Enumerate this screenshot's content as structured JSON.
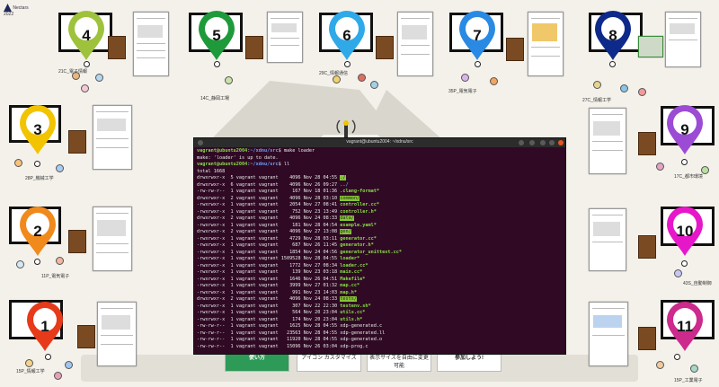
{
  "logo": {
    "text": "Nectars 2022",
    "mark_color": "#1d2a5a"
  },
  "booths": [
    {
      "num": "4",
      "color": "#9ec23c",
      "label": "21C_電子情報"
    },
    {
      "num": "5",
      "color": "#1e9a3a",
      "label": "14C_静岡工場"
    },
    {
      "num": "6",
      "color": "#2fa9e8",
      "label": "29C_情報通信"
    },
    {
      "num": "7",
      "color": "#2a8ae3",
      "label": "35P_電気電子"
    },
    {
      "num": "8",
      "color": "#0d2a8a",
      "label": "27C_情報工学"
    },
    {
      "num": "3",
      "color": "#f2c400",
      "label": "28P_機械工学"
    },
    {
      "num": "9",
      "color": "#9b4bd4",
      "label": "17C_都市環境"
    },
    {
      "num": "2",
      "color": "#f08a1c",
      "label": "11P_電気電子"
    },
    {
      "num": "10",
      "color": "#e617c8",
      "label": "43S_自動制御"
    },
    {
      "num": "1",
      "color": "#e63a1a",
      "label": "15P_情報工学"
    },
    {
      "num": "11",
      "color": "#cc2a8c",
      "label": "15P_工業電子"
    }
  ],
  "terminal": {
    "title": "vagrant@ubuntu2004: ~/xdnu/src",
    "user": "vagrant@ubuntu2004",
    "path": "~/xdnu/src",
    "lines": [
      {
        "kind": "cmd",
        "text": "make loader"
      },
      {
        "kind": "out",
        "text": "make: 'loader' is up to date."
      },
      {
        "kind": "cmd",
        "text": "ll"
      },
      {
        "kind": "out",
        "text": "total 1668"
      },
      {
        "kind": "ls",
        "meta": "drwxrwxr-x  5 vagrant vagrant    4096 Nov 28 04:55 ",
        "name": "./",
        "style": "dirhl"
      },
      {
        "kind": "ls",
        "meta": "drwxrwxr-x  6 vagrant vagrant    4096 Nov 26 09:27 ",
        "name": "../",
        "style": "dir"
      },
      {
        "kind": "ls",
        "meta": "-rw-rw-r--  1 vagrant vagrant     167 Nov 18 01:36 ",
        "name": ".clang-format*",
        "style": "exe"
      },
      {
        "kind": "ls",
        "meta": "drwxrwxr-x  2 vagrant vagrant    4096 Nov 28 03:10 ",
        "name": "common/",
        "style": "dirhl"
      },
      {
        "kind": "ls",
        "meta": "-rwxrwxr-x  1 vagrant vagrant    2054 Nov 27 08:41 ",
        "name": "controller.cc*",
        "style": "exe"
      },
      {
        "kind": "ls",
        "meta": "-rwxrwxr-x  1 vagrant vagrant     752 Nov 23 13:49 ",
        "name": "controller.h*",
        "style": "exe"
      },
      {
        "kind": "ls",
        "meta": "drwxrwxr-x  2 vagrant vagrant    4096 Nov 24 08:33 ",
        "name": "data/",
        "style": "dirhl"
      },
      {
        "kind": "ls",
        "meta": "-rwxrwxr-x  1 vagrant vagrant     181 Nov 28 04:54 ",
        "name": "example.yaml*",
        "style": "exe"
      },
      {
        "kind": "ls",
        "meta": "drwxrwxr-x  2 vagrant vagrant    4096 Nov 27 13:08 ",
        "name": "gen/",
        "style": "dirhl"
      },
      {
        "kind": "ls",
        "meta": "-rwxrwxr-x  1 vagrant vagrant    4729 Nov 28 03:11 ",
        "name": "generator.cc*",
        "style": "exe"
      },
      {
        "kind": "ls",
        "meta": "-rwxrwxr-x  1 vagrant vagrant     687 Nov 26 11:45 ",
        "name": "generator.h*",
        "style": "exe"
      },
      {
        "kind": "ls",
        "meta": "-rwxrwxr-x  1 vagrant vagrant    1854 Nov 24 04:56 ",
        "name": "generator_unittest.cc*",
        "style": "exe"
      },
      {
        "kind": "ls",
        "meta": "-rwxrwxr-x  1 vagrant vagrant 1509528 Nov 28 04:55 ",
        "name": "loader*",
        "style": "exe"
      },
      {
        "kind": "ls",
        "meta": "-rwxrwxr-x  1 vagrant vagrant    1772 Nov 27 08:34 ",
        "name": "loader.cc*",
        "style": "exe"
      },
      {
        "kind": "ls",
        "meta": "-rwxrwxr-x  1 vagrant vagrant     139 Nov 23 03:18 ",
        "name": "main.cc*",
        "style": "exe"
      },
      {
        "kind": "ls",
        "meta": "-rwxrwxr-x  1 vagrant vagrant    1646 Nov 26 04:51 ",
        "name": "Makefile*",
        "style": "exe"
      },
      {
        "kind": "ls",
        "meta": "-rwxrwxr-x  1 vagrant vagrant    3999 Nov 27 01:32 ",
        "name": "map.cc*",
        "style": "exe"
      },
      {
        "kind": "ls",
        "meta": "-rwxrwxr-x  1 vagrant vagrant     991 Nov 23 14:03 ",
        "name": "map.h*",
        "style": "exe"
      },
      {
        "kind": "ls",
        "meta": "drwxrwxr-x  2 vagrant vagrant    4096 Nov 24 08:33 ",
        "name": "tests/",
        "style": "dirhl"
      },
      {
        "kind": "ls",
        "meta": "-rwxrwxr-x  1 vagrant vagrant     307 Nov 22 22:30 ",
        "name": "testenv.sh*",
        "style": "exe"
      },
      {
        "kind": "ls",
        "meta": "-rwxrwxr-x  1 vagrant vagrant     564 Nov 20 23:04 ",
        "name": "utils.cc*",
        "style": "exe"
      },
      {
        "kind": "ls",
        "meta": "-rwxrwxr-x  1 vagrant vagrant     174 Nov 20 23:04 ",
        "name": "utils.h*",
        "style": "exe"
      },
      {
        "kind": "ls",
        "meta": "-rw-rw-r--  1 vagrant vagrant    1625 Nov 28 04:55 ",
        "name": "xdp-generated.c",
        "style": "plain"
      },
      {
        "kind": "ls",
        "meta": "-rw-rw-r--  1 vagrant vagrant   23563 Nov 28 04:55 ",
        "name": "xdp-generated.ll",
        "style": "plain"
      },
      {
        "kind": "ls",
        "meta": "-rw-rw-r--  1 vagrant vagrant   11920 Nov 28 04:55 ",
        "name": "xdp-generated.o",
        "style": "plain"
      },
      {
        "kind": "ls",
        "meta": "-rw-rw-r--  1 vagrant vagrant   15096 Nov 26 03:04 ",
        "name": "xdp-prog.c",
        "style": "plain"
      }
    ]
  },
  "ads": [
    {
      "text": "使い方",
      "bg": "#2e9a57"
    },
    {
      "text": "アイコン カスタマイズ",
      "bg": "#ffffff"
    },
    {
      "text": "表示サイズを自由に変更可能",
      "bg": "#ffffff"
    },
    {
      "text": "参加しよう!",
      "bg": "#ffffff"
    }
  ]
}
